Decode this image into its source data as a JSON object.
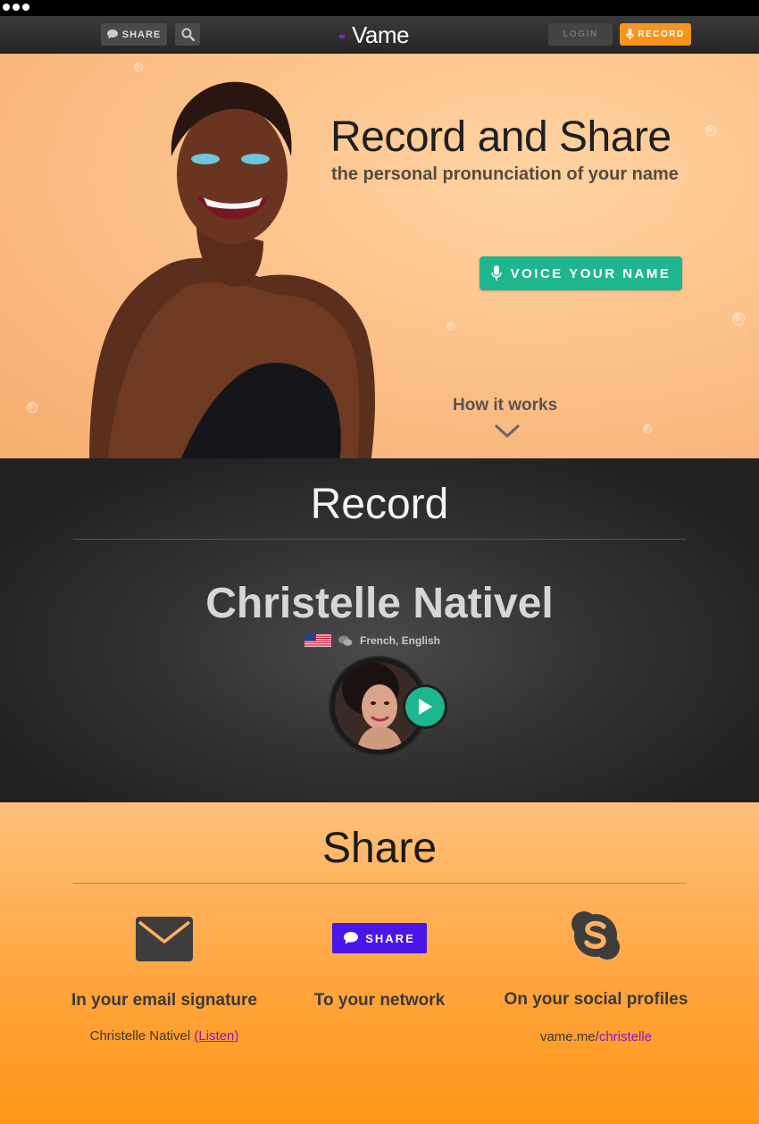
{
  "colors": {
    "accent_green": "#1fb58f",
    "accent_orange": "#f7941d",
    "accent_purple": "#4a16e8",
    "link_purple": "#8a16c8"
  },
  "nav": {
    "share_label": "SHARE",
    "share_icon": "speech-bubble-icon",
    "search_icon": "search-icon",
    "logo_text": "Vame",
    "login_label": "LOGIN",
    "record_label": "RECORD",
    "record_icon": "microphone-icon"
  },
  "hero": {
    "title": "Record and Share",
    "subtitle": "the personal pronunciation of your name",
    "cta_label": "VOICE YOUR NAME",
    "cta_icon": "microphone-icon",
    "how_label": "How it works",
    "how_icon": "chevron-down-icon"
  },
  "record": {
    "title": "Record",
    "person_name": "Christelle Nativel",
    "flag_icon": "us-flag-icon",
    "languages_icon": "chat-bubbles-icon",
    "languages": "French, English",
    "play_icon": "play-icon"
  },
  "share": {
    "title": "Share",
    "email": {
      "icon": "envelope-icon",
      "heading": "In your email signature",
      "name": "Christelle Nativel",
      "listen": "(Listen)"
    },
    "network": {
      "button_label": "SHARE",
      "button_icon": "speech-bubble-icon",
      "heading": "To your network"
    },
    "social": {
      "icon": "skype-icon",
      "heading": "On your social profiles",
      "url_prefix": "vame.me/",
      "url_slug": "christelle"
    }
  }
}
